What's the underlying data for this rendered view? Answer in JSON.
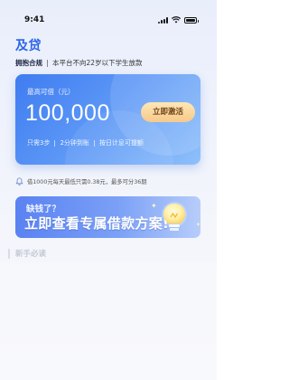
{
  "status_bar": {
    "time": "9:41"
  },
  "header": {
    "title": "及贷",
    "tag": "拥抱合规",
    "notice": "本平台不向22岁以下学生放款"
  },
  "hero": {
    "max_label": "最高可借（元）",
    "max_amount": "100,000",
    "cta_label": "立即激活",
    "features": [
      "只需3步",
      "2分钟到账",
      "按日计息可提额"
    ]
  },
  "notice_line": {
    "text": "借1000元每天最低只需0.38元，最多可分36期"
  },
  "promo": {
    "line1": "缺钱了？",
    "line2": "立即查看专属借款方案!"
  },
  "section": {
    "title": "新手必读"
  },
  "colors": {
    "brand_blue": "#2c64e8",
    "cta_gold": "#f6c98a"
  }
}
